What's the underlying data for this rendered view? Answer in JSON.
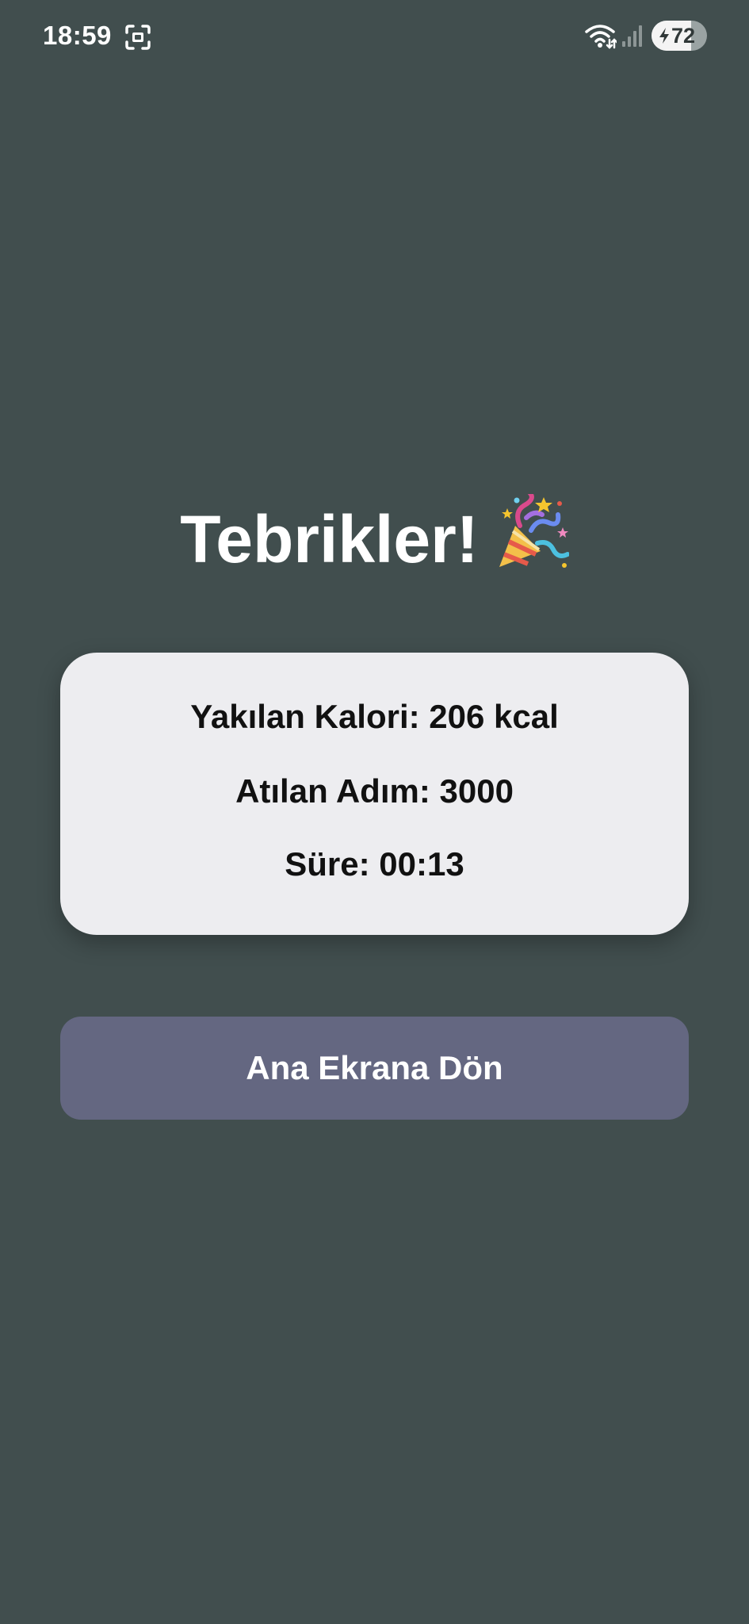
{
  "status_bar": {
    "time": "18:59",
    "battery_level": "72",
    "battery_fraction": 0.72,
    "icons": [
      "screenshot-icon",
      "wifi-icon",
      "signal-icon",
      "battery-charging-icon"
    ]
  },
  "summary": {
    "title": "Tebrikler!",
    "title_emoji_icon": "party-popper-icon",
    "calories": "Yakılan Kalori: 206 kcal",
    "steps": "Atılan Adım: 3000",
    "duration": "Süre: 00:13"
  },
  "actions": {
    "home_button_label": "Ana Ekrana Dön"
  },
  "colors": {
    "background": "#414e4e",
    "card": "#ededf0",
    "button": "#646781",
    "text_light": "#ffffff",
    "text_dark": "#111111"
  }
}
